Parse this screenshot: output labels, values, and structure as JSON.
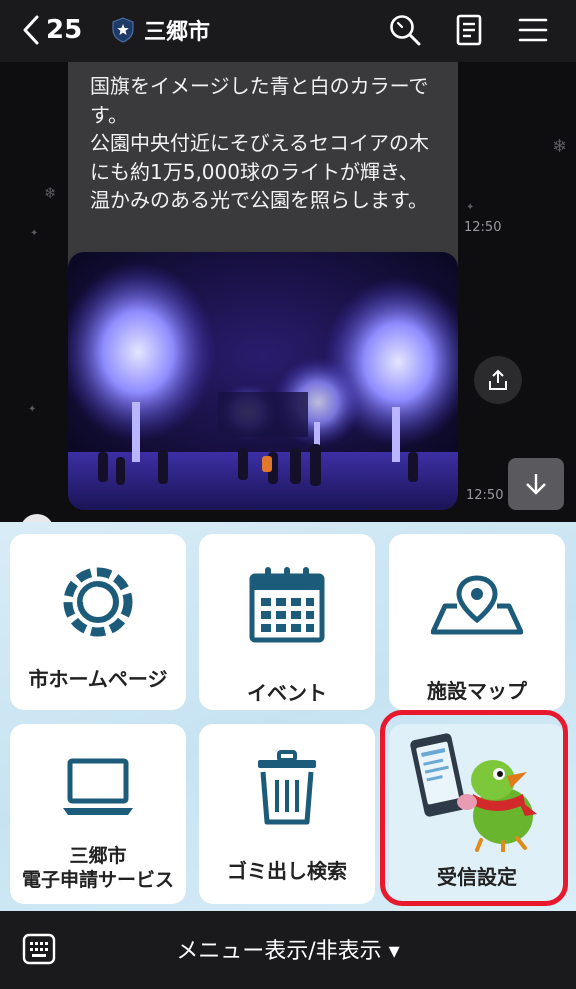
{
  "header": {
    "unread_count": "25",
    "title": "三郷市",
    "icons": [
      "chevron-left-icon",
      "shield-star-icon",
      "search-icon",
      "note-icon",
      "menu-icon"
    ]
  },
  "chat": {
    "message_text": "国旗をイメージした青と白のカラーです。\n公園中央付近にそびえるセコイアの木にも約1万5,000球のライトが輝き、温かみのある光で公園を照らします。",
    "message_time": "12:50",
    "photo_time": "12:50",
    "photo_description": "illuminated-trees-photo"
  },
  "rich_menu": {
    "items": [
      {
        "label": "市ホームページ",
        "icon": "city-emblem-icon"
      },
      {
        "label": "イベント",
        "icon": "calendar-icon"
      },
      {
        "label": "施設マップ",
        "icon": "map-pin-icon"
      },
      {
        "label_line1": "三郷市",
        "label_line2": "電子申請サービス",
        "icon": "laptop-icon"
      },
      {
        "label": "ゴミ出し検索",
        "icon": "trash-icon"
      },
      {
        "label": "受信設定",
        "icon": "mascot-phone-icon"
      }
    ],
    "highlight_color": "#e8192c",
    "accent_color": "#1d5b7a"
  },
  "footer": {
    "toggle_label": "メニュー表示/非表示 ▾"
  }
}
